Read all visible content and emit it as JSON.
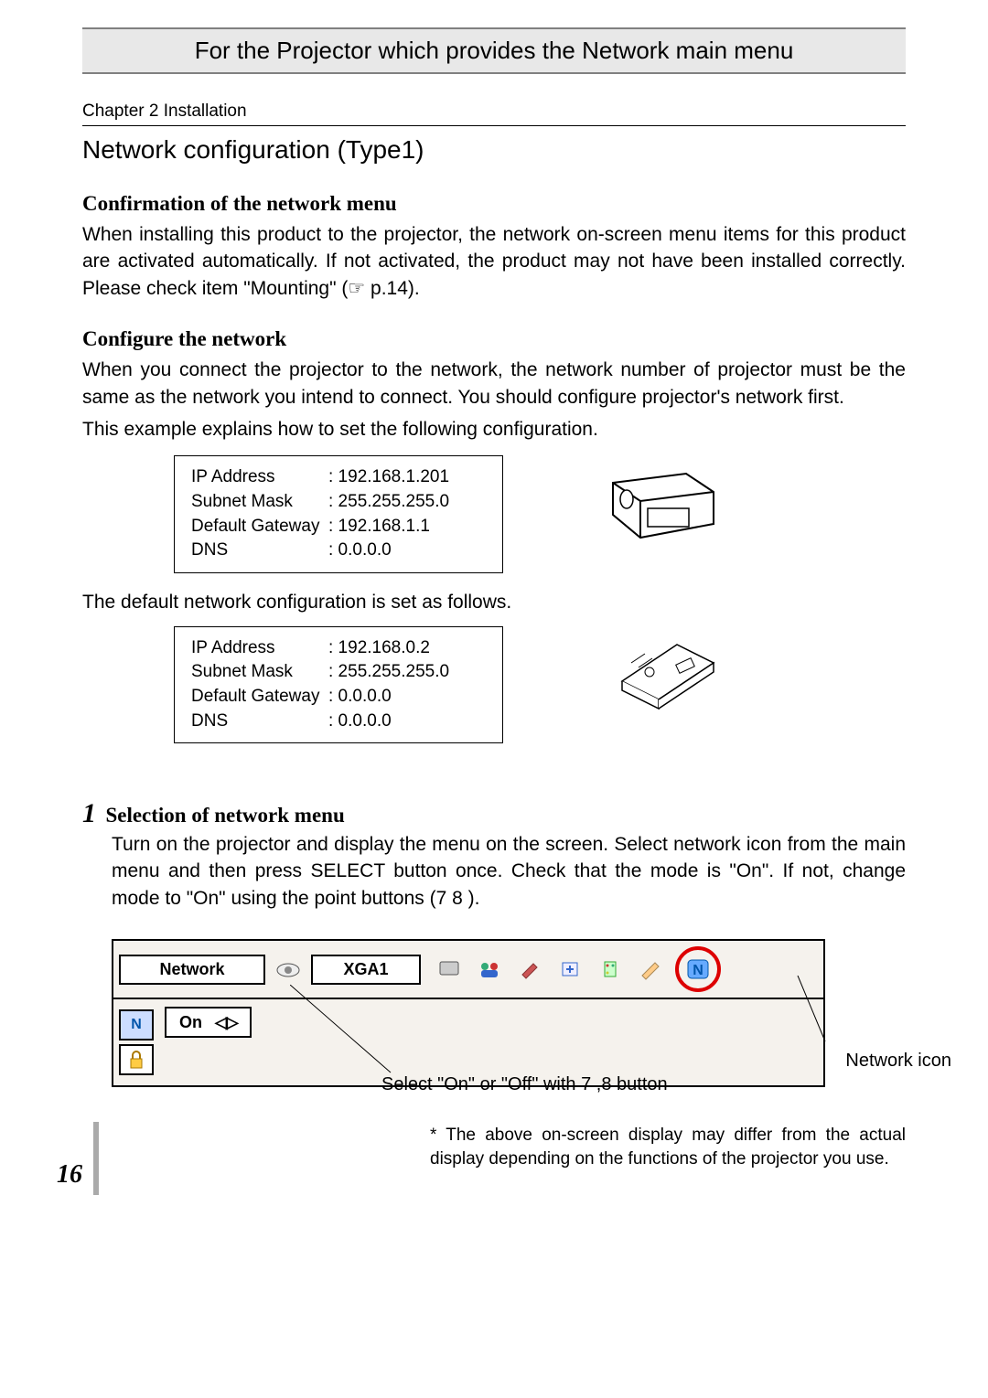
{
  "header": "For the Projector which provides the Network main menu",
  "chapter": "Chapter 2 Installation",
  "section_title": "Network configuration (Type1)",
  "subsection1": {
    "title": "Confirmation of the network menu",
    "body": "When installing this product to the projector, the network on-screen menu items for this product are activated automatically. If not activated, the product may not have been installed correctly. Please check item \"Mounting\" (☞ p.14)."
  },
  "subsection2": {
    "title": "Configure the network",
    "body1": "When you connect the projector to the network, the network number of projector must be the same as the network you intend to connect. You should configure projector's network first.",
    "body2": "This example explains how to set the following configuration."
  },
  "config_example": {
    "rows": [
      {
        "label": "IP Address",
        "value": ": 192.168.1.201"
      },
      {
        "label": "Subnet Mask",
        "value": ": 255.255.255.0"
      },
      {
        "label": "Default Gateway",
        "value": ": 192.168.1.1"
      },
      {
        "label": "DNS",
        "value": ": 0.0.0.0"
      }
    ]
  },
  "default_text": "The default network configuration is set as follows.",
  "config_default": {
    "rows": [
      {
        "label": "IP Address",
        "value": ": 192.168.0.2"
      },
      {
        "label": "Subnet Mask",
        "value": ": 255.255.255.0"
      },
      {
        "label": "Default Gateway",
        "value": ": 0.0.0.0"
      },
      {
        "label": "DNS",
        "value": ": 0.0.0.0"
      }
    ]
  },
  "step1": {
    "num": "1",
    "title": "Selection of network menu",
    "body": "Turn on the projector and display the menu on the screen. Select network icon from the main menu and then press SELECT button once. Check that the mode is \"On\". If not, change mode to \"On\" using the point buttons (7 8 )."
  },
  "osd": {
    "tab_label": "Network",
    "mode_label": "XGA1",
    "on_label": "On",
    "arrows": "◁▷"
  },
  "annotations": {
    "select_on_off": "Select \"On\" or \"Off\" with 7 ,8  button",
    "network_icon": "Network icon"
  },
  "footnote": "* The above on-screen display may differ from the actual display depending on the functions of the projector you use.",
  "page_number": "16"
}
